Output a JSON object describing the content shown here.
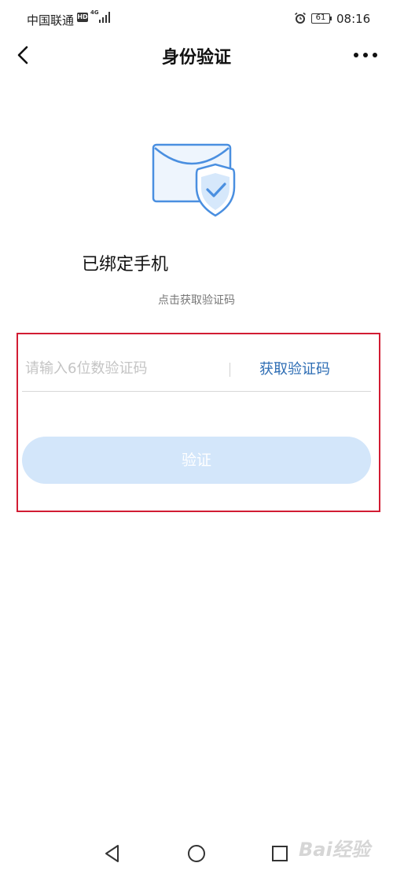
{
  "status_bar": {
    "carrier": "中国联通",
    "hd": "HD",
    "net_type": "4G",
    "battery": "61",
    "time": "08:16"
  },
  "header": {
    "title": "身份验证"
  },
  "main": {
    "bound_phone": "已绑定手机",
    "hint": "点击获取验证码",
    "code_input": {
      "placeholder": "请输入6位数验证码",
      "value": ""
    },
    "get_code_label": "获取验证码",
    "verify_label": "验证"
  },
  "watermark": "Bai经验",
  "colors": {
    "accent": "#2d6db4",
    "button_disabled": "#d3e6fa",
    "highlight": "#d21c33",
    "illustration_blue": "#4a8fe0"
  },
  "icons": [
    "back-icon",
    "more-icon",
    "envelope-shield-icon",
    "alarm-icon",
    "signal-icon",
    "battery-icon",
    "nav-back-icon",
    "nav-home-icon",
    "nav-recent-icon"
  ]
}
